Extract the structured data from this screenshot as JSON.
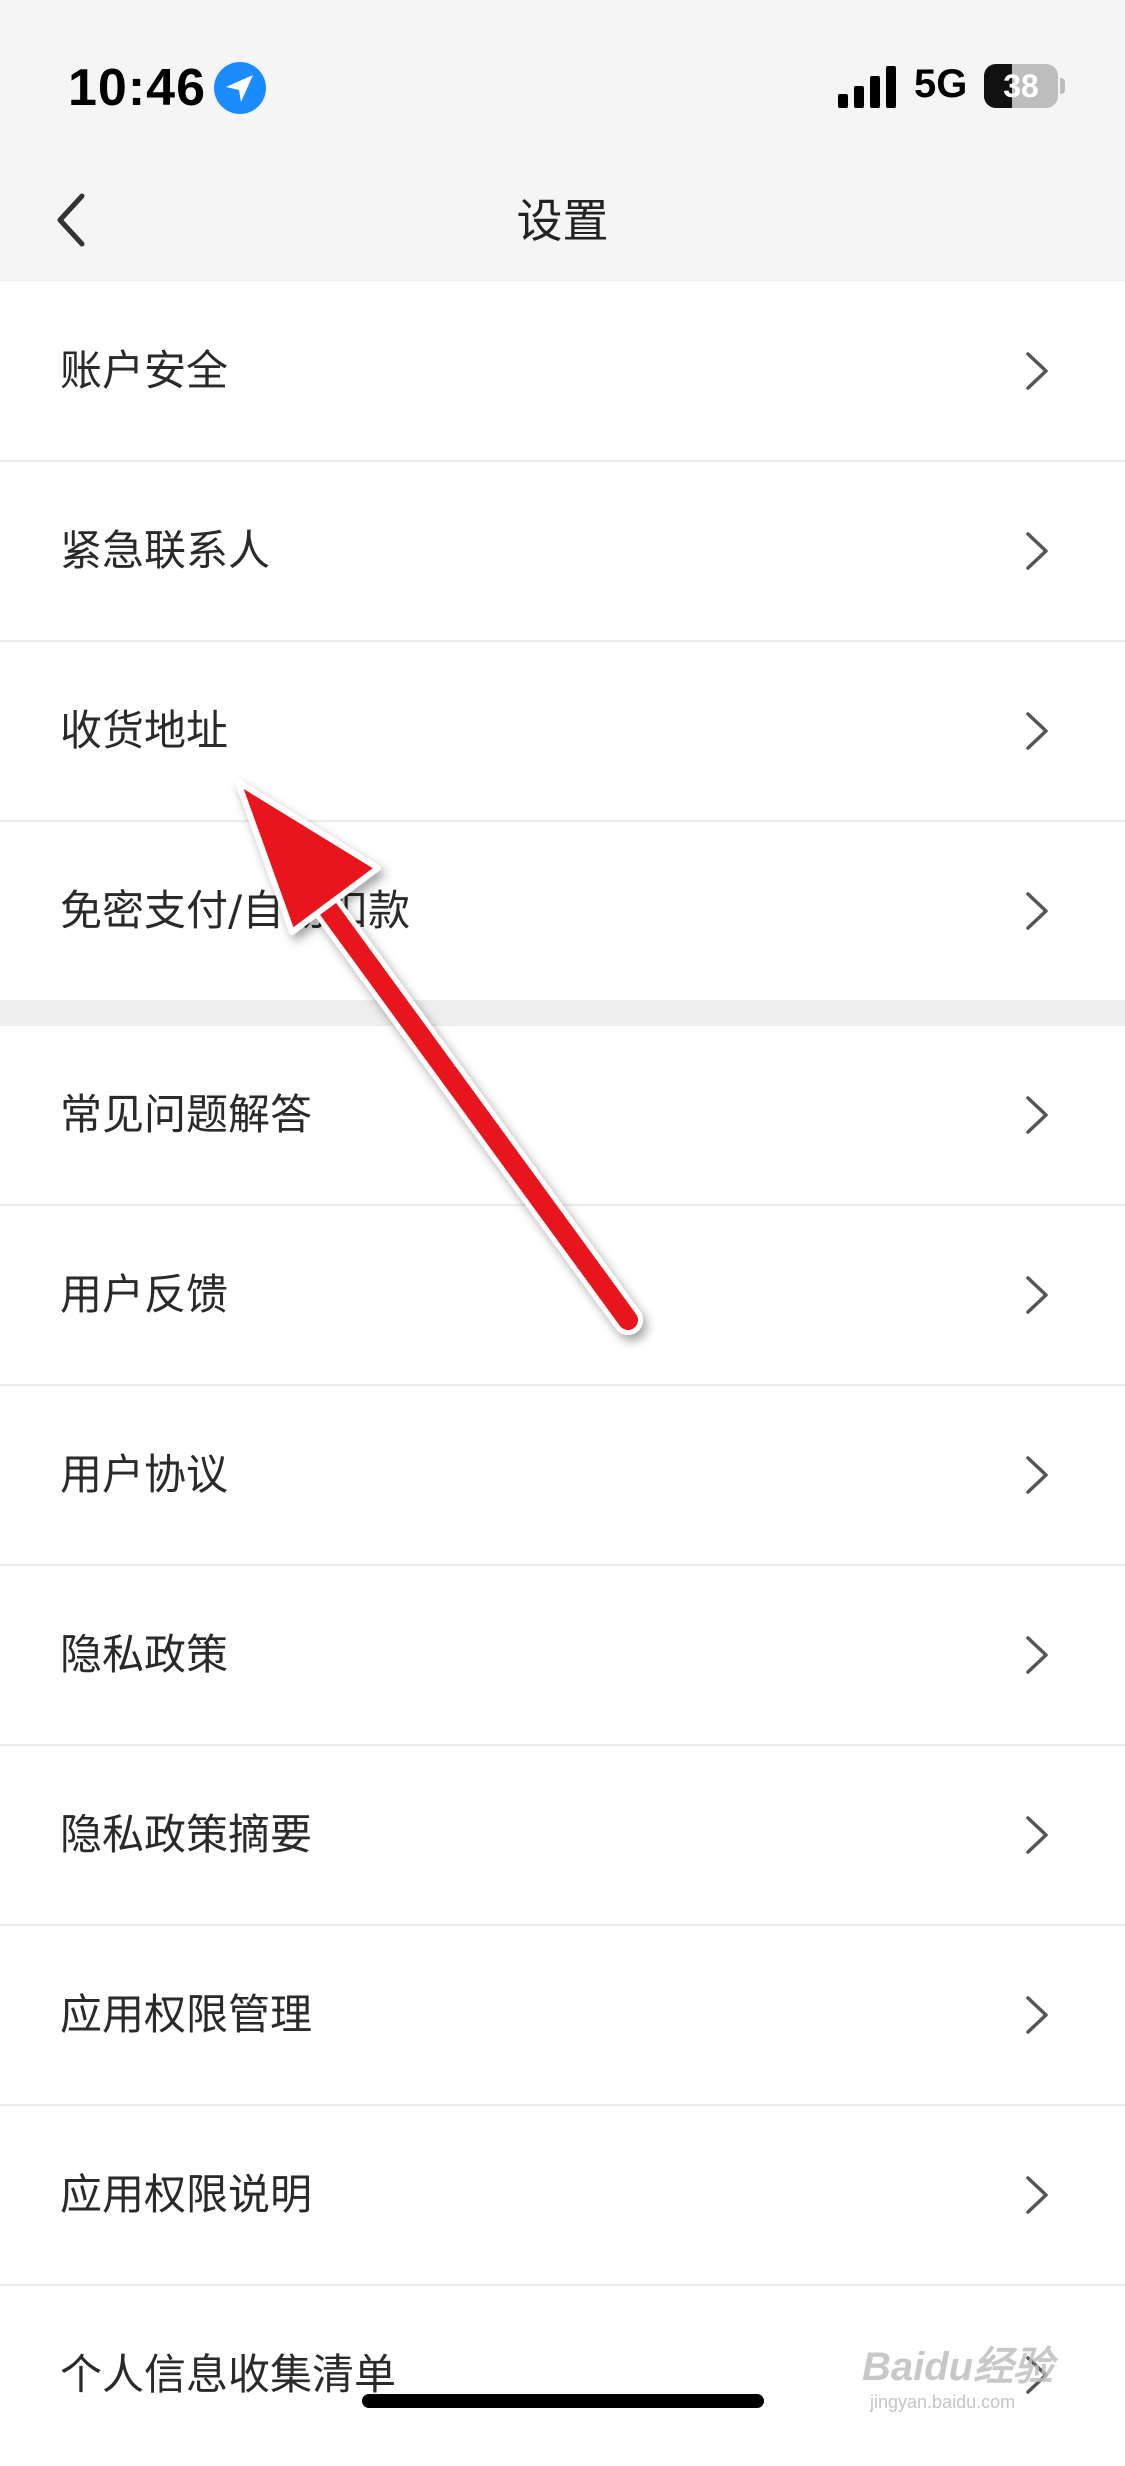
{
  "status_bar": {
    "time": "10:46",
    "network": "5G",
    "battery_level": "38",
    "battery_fraction": 0.38,
    "location_icon": "location-arrow-icon",
    "signal_icon": "cellular-signal-icon"
  },
  "nav": {
    "title": "设置",
    "back_icon": "chevron-left-icon"
  },
  "groups": [
    {
      "items": [
        {
          "label": "账户安全"
        },
        {
          "label": "紧急联系人"
        },
        {
          "label": "收货地址"
        },
        {
          "label": "免密支付/自动扣款"
        }
      ]
    },
    {
      "items": [
        {
          "label": "常见问题解答"
        },
        {
          "label": "用户反馈"
        },
        {
          "label": "用户协议"
        },
        {
          "label": "隐私政策"
        },
        {
          "label": "隐私政策摘要"
        },
        {
          "label": "应用权限管理"
        },
        {
          "label": "应用权限说明"
        },
        {
          "label": "个人信息收集清单"
        }
      ]
    }
  ],
  "watermark": {
    "brand": "Baidu经验",
    "url": "jingyan.baidu.com"
  },
  "colors": {
    "accent_location": "#1a8cff",
    "annotation_arrow": "#e8141c",
    "background": "#f5f5f5",
    "list_background": "#ffffff"
  }
}
